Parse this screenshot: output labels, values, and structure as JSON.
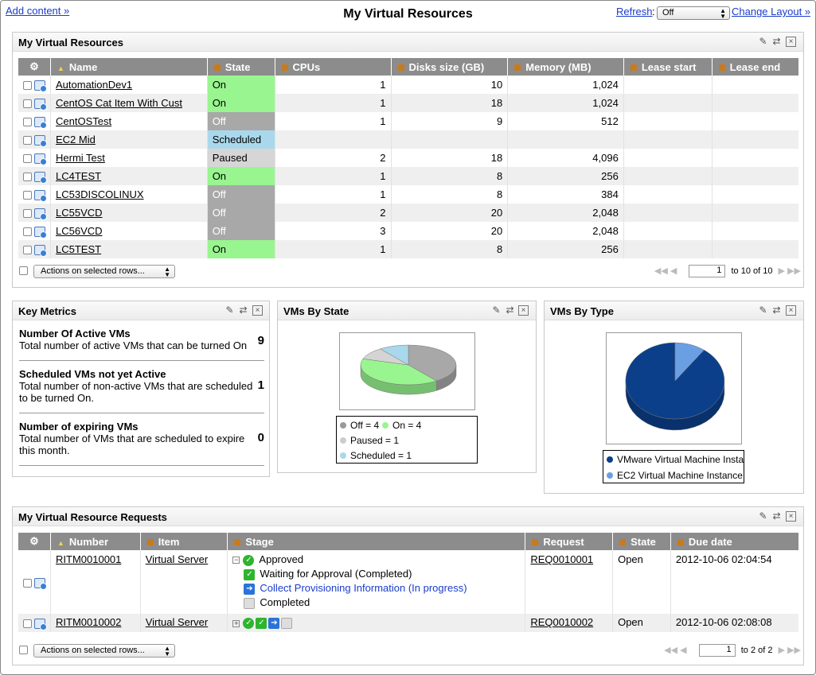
{
  "top": {
    "add_content": "Add content »",
    "title": "My Virtual Resources",
    "refresh_label": "Refresh",
    "refresh_value": "Off",
    "change_layout": "Change Layout »"
  },
  "vr": {
    "title": "My Virtual Resources",
    "columns": [
      "Name",
      "State",
      "CPUs",
      "Disks size (GB)",
      "Memory (MB)",
      "Lease start",
      "Lease end"
    ],
    "rows": [
      {
        "name": "AutomationDev1",
        "state": "On",
        "cpus": "1",
        "disk": "10",
        "mem": "1,024"
      },
      {
        "name": "CentOS Cat Item With Cust",
        "state": "On",
        "cpus": "1",
        "disk": "18",
        "mem": "1,024"
      },
      {
        "name": "CentOSTest",
        "state": "Off",
        "cpus": "1",
        "disk": "9",
        "mem": "512"
      },
      {
        "name": "EC2 Mid",
        "state": "Scheduled",
        "cpus": "",
        "disk": "",
        "mem": ""
      },
      {
        "name": "Hermi Test",
        "state": "Paused",
        "cpus": "2",
        "disk": "18",
        "mem": "4,096"
      },
      {
        "name": "LC4TEST",
        "state": "On",
        "cpus": "1",
        "disk": "8",
        "mem": "256"
      },
      {
        "name": "LC53DISCOLINUX",
        "state": "Off",
        "cpus": "1",
        "disk": "8",
        "mem": "384"
      },
      {
        "name": "LC55VCD",
        "state": "Off",
        "cpus": "2",
        "disk": "20",
        "mem": "2,048"
      },
      {
        "name": "LC56VCD",
        "state": "Off",
        "cpus": "3",
        "disk": "20",
        "mem": "2,048"
      },
      {
        "name": "LC5TEST",
        "state": "On",
        "cpus": "1",
        "disk": "8",
        "mem": "256"
      }
    ],
    "actions": "Actions on selected rows...",
    "page": "1",
    "page_text": "to 10 of 10"
  },
  "metrics": {
    "title": "Key Metrics",
    "items": [
      {
        "title": "Number Of Active VMs",
        "desc": "Total number of active VMs that can be turned On",
        "value": "9"
      },
      {
        "title": "Scheduled VMs not yet Active",
        "desc": "Total number of non-active VMs that are scheduled to be turned On.",
        "value": "1"
      },
      {
        "title": "Number of expiring VMs",
        "desc": "Total number of VMs that are scheduled to expire this month.",
        "value": "0"
      }
    ]
  },
  "colors": {
    "off": "#a8a8a8",
    "on": "#99f58f",
    "paused": "#d4d4d4",
    "scheduled": "#a9d8ec",
    "vmware": "#0b3f8a",
    "ec2": "#6b9fe4"
  },
  "chart_data": [
    {
      "type": "pie",
      "title": "VMs By State",
      "categories": [
        "Off",
        "On",
        "Paused",
        "Scheduled"
      ],
      "values": [
        4,
        4,
        1,
        1
      ],
      "legend": [
        "Off = 4",
        "On = 4",
        "Paused = 1",
        "Scheduled = 1"
      ]
    },
    {
      "type": "pie",
      "title": "VMs By Type",
      "categories": [
        "VMware Virtual Machine Instance",
        "EC2 Virtual Machine Instance"
      ],
      "values": [
        9,
        1
      ],
      "legend": [
        "VMware Virtual Machine Insta",
        "EC2 Virtual Machine Instance"
      ]
    }
  ],
  "req": {
    "title": "My Virtual Resource Requests",
    "columns": [
      "Number",
      "Item",
      "Stage",
      "Request",
      "State",
      "Due date"
    ],
    "rows": [
      {
        "number": "RITM0010001",
        "item": "Virtual Server",
        "stages": [
          "Approved",
          "Waiting for Approval (Completed)",
          "Collect Provisioning Information (In progress)",
          "Completed"
        ],
        "request": "REQ0010001",
        "state": "Open",
        "due": "2012-10-06 02:04:54"
      },
      {
        "number": "RITM0010002",
        "item": "Virtual Server",
        "request": "REQ0010002",
        "state": "Open",
        "due": "2012-10-06 02:08:08"
      }
    ],
    "actions": "Actions on selected rows...",
    "page": "1",
    "page_text": "to 2 of 2"
  }
}
